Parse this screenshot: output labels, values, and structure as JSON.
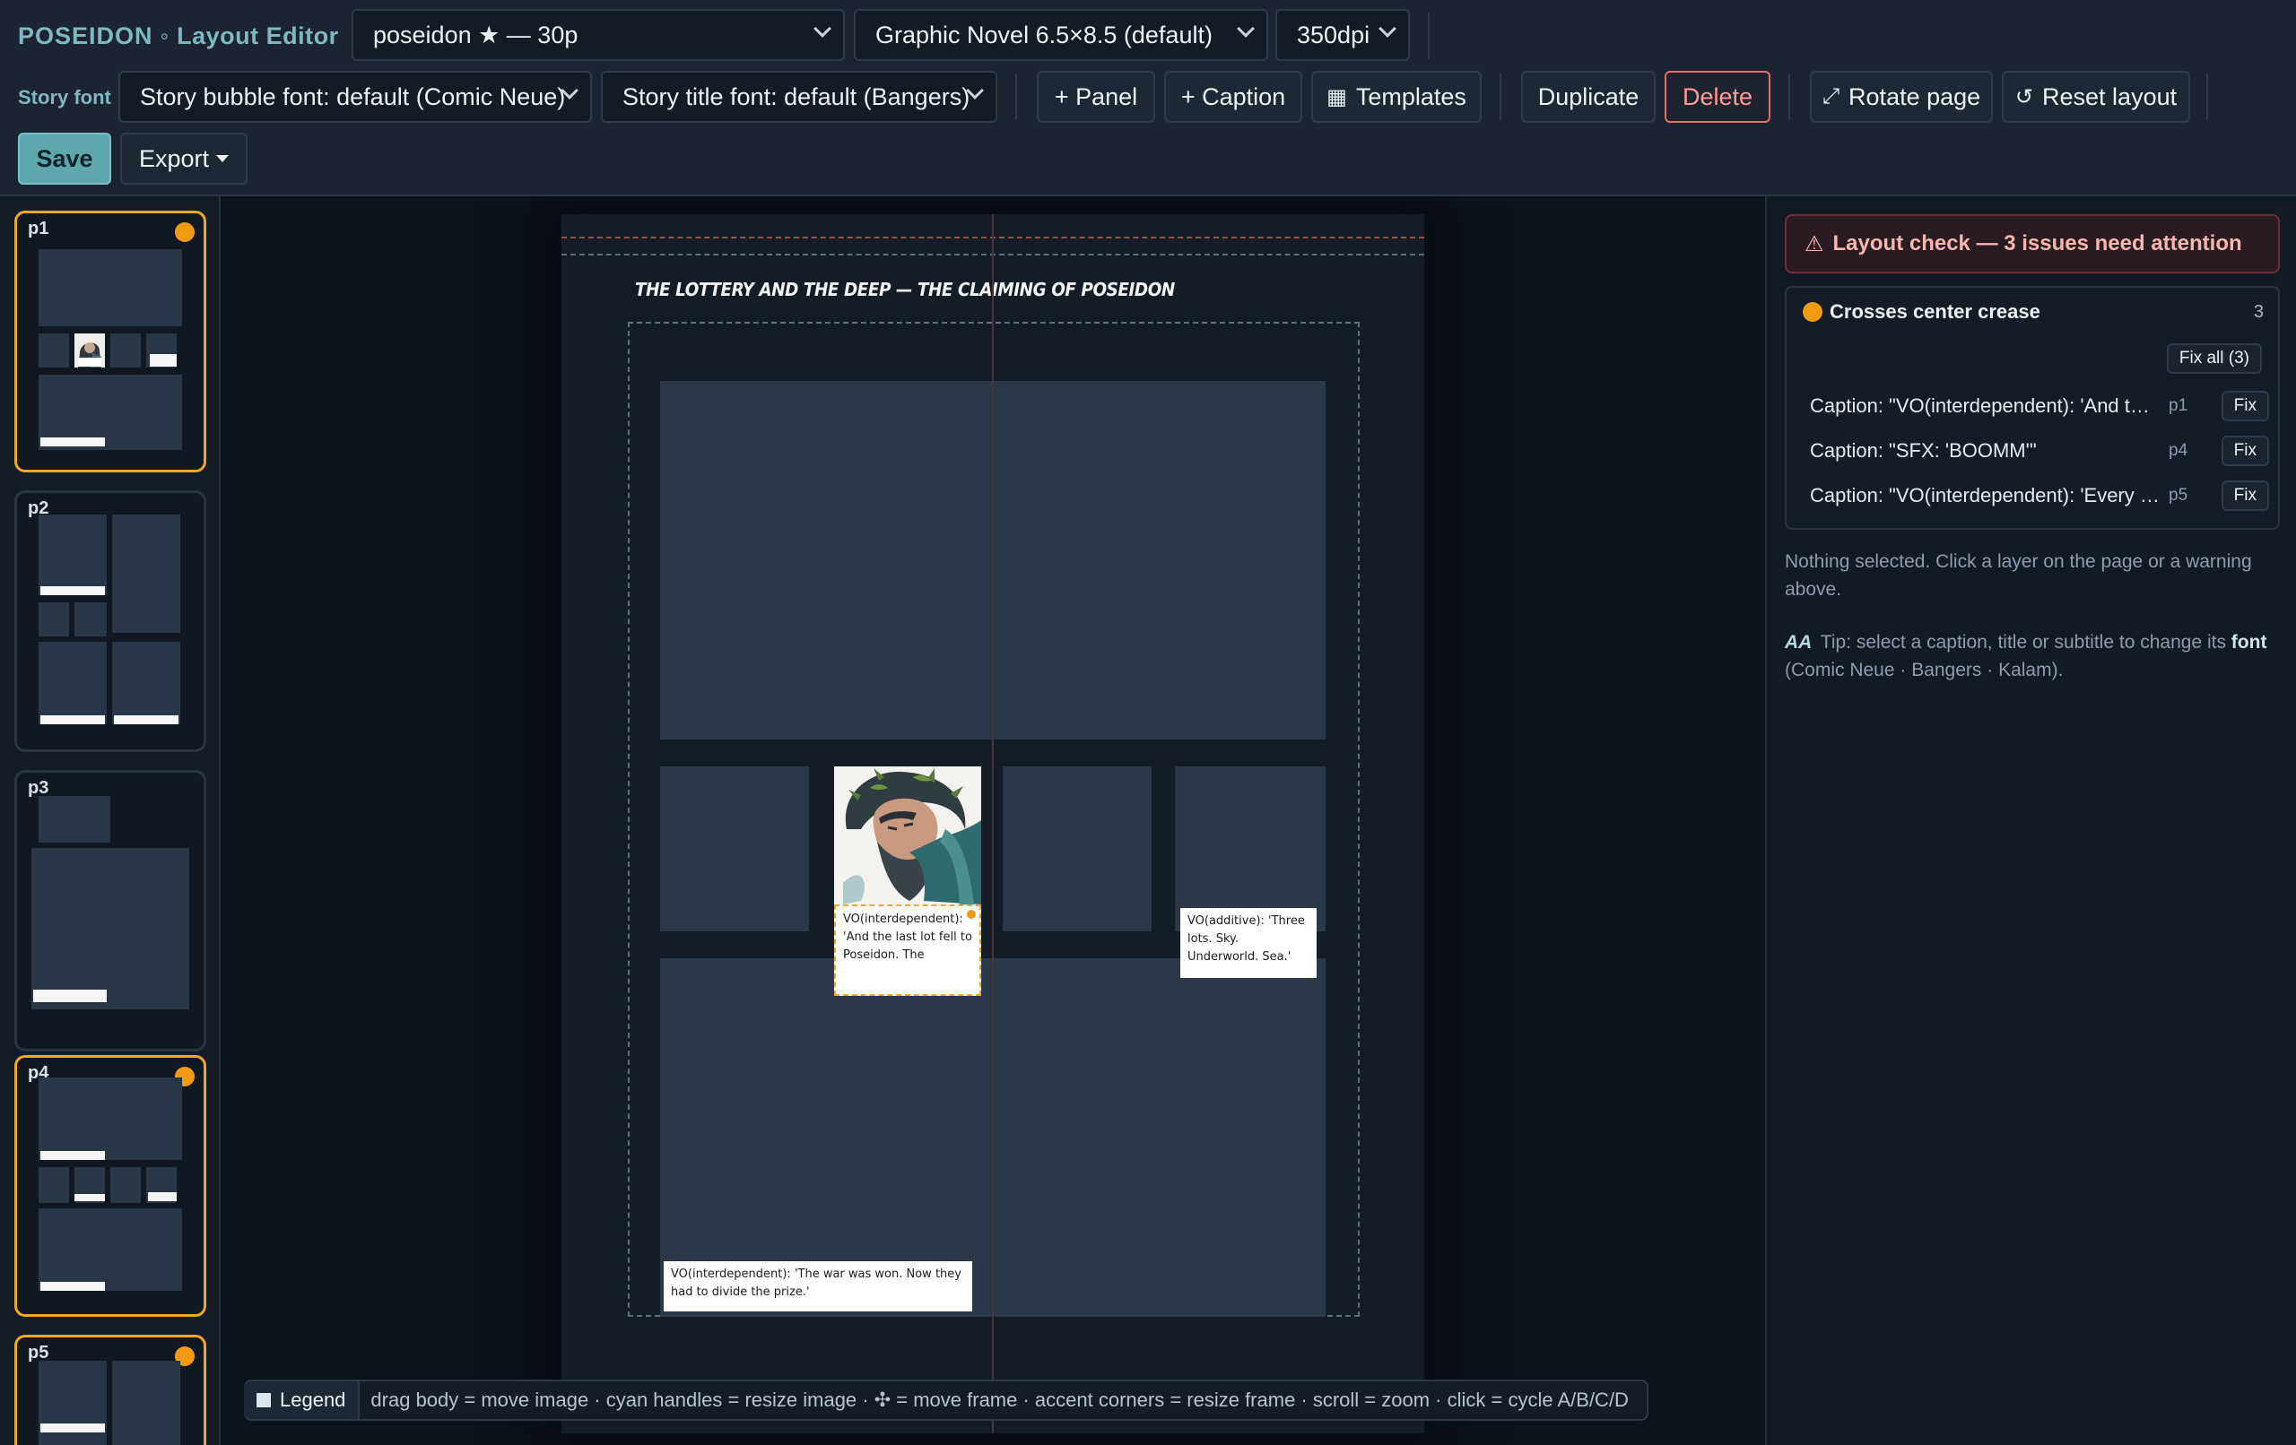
{
  "app": {
    "brand": "POSEIDON",
    "brand_sep": "◦",
    "brand_sub": "Layout Editor"
  },
  "toolbar": {
    "project_select": "poseidon ★ — 30p",
    "format_select": "Graphic Novel 6.5×8.5 (default)",
    "dpi_select": "350dpi",
    "story_font_label": "Story font",
    "bubble_font_select": "Story bubble font: default (Comic Neue)",
    "title_font_select": "Story title font: default (Bangers)",
    "add_panel": "+ Panel",
    "add_caption": "+ Caption",
    "templates": "Templates",
    "duplicate": "Duplicate",
    "delete": "Delete",
    "rotate_page": "Rotate page",
    "reset_layout": "Reset layout",
    "save": "Save",
    "export": "Export"
  },
  "thumbnails": [
    {
      "label": "p1",
      "flagged": true
    },
    {
      "label": "p2",
      "flagged": false
    },
    {
      "label": "p3",
      "flagged": false
    },
    {
      "label": "p4",
      "flagged": true
    },
    {
      "label": "p5",
      "flagged": true
    }
  ],
  "page": {
    "title": "THE LOTTERY AND THE DEEP — THE CLAIMING OF POSEIDON",
    "captions": {
      "interdependent_1": "VO(interdependent): 'And the last lot fell to Poseidon. The",
      "additive": "VO(additive): 'Three lots. Sky. Underworld. Sea.'",
      "interdependent_2": "VO(interdependent): 'The war was won. Now they had to divide the prize.'"
    }
  },
  "legend": {
    "button": "Legend",
    "text": "drag body = move image · cyan handles = resize image · ✣ = move frame · accent corners = resize frame · scroll = zoom · click = cycle A/B/C/D"
  },
  "inspector": {
    "alert": "Layout check — 3 issues need attention",
    "group_title": "Crosses center crease",
    "group_count": "3",
    "fix_all": "Fix all (3)",
    "issues": [
      {
        "text": "Caption: \"VO(interdependent): 'And th…",
        "page": "p1",
        "fix": "Fix"
      },
      {
        "text": "Caption: \"SFX: 'BOOMM'\"",
        "page": "p4",
        "fix": "Fix"
      },
      {
        "text": "Caption: \"VO(interdependent): 'Every t…",
        "page": "p5",
        "fix": "Fix"
      }
    ],
    "nothing_selected": "Nothing selected. Click a layer on the page or a warning above.",
    "tip_glyph": "AA",
    "tip_prefix": "Tip: select a caption, title or subtitle to change its",
    "tip_font_word": "font",
    "tip_fonts": "(Comic Neue · Bangers · Kalam)."
  },
  "colors": {
    "accent": "#7fb7c2",
    "warning": "#f29a11",
    "danger": "#e0706b",
    "save": "#5fa7ae"
  }
}
